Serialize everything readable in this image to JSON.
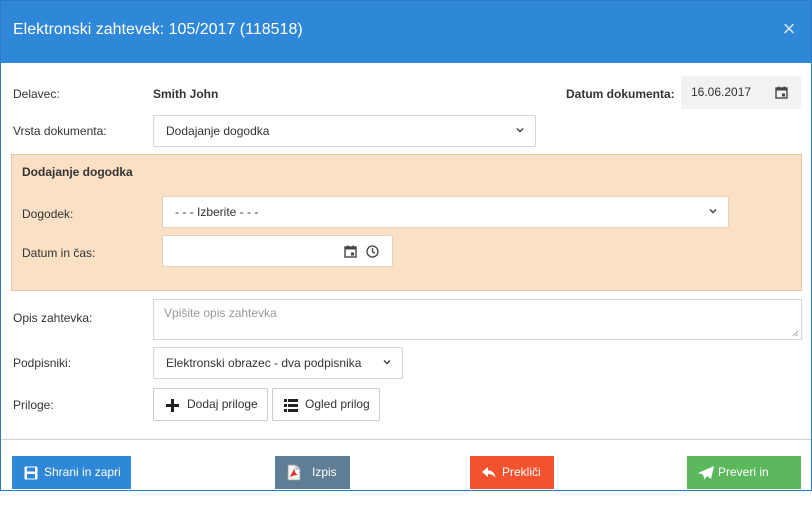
{
  "dialog": {
    "title": "Elektronski zahtevek: 105/2017 (118518)",
    "close_glyph": "×"
  },
  "worker": {
    "label": "Delavec:",
    "value": "Smith John"
  },
  "doc_date": {
    "label": "Datum dokumenta:",
    "value": "16.06.2017"
  },
  "doc_type": {
    "label": "Vrsta dokumenta:",
    "value": "Dodajanje dogodka"
  },
  "event_panel": {
    "title": "Dodajanje dogodka",
    "event_label": "Dogodek:",
    "event_value": "- - - Izberite - - -",
    "datetime_label": "Datum in čas:",
    "datetime_value": ""
  },
  "description": {
    "label": "Opis zahtevka:",
    "placeholder": "Vpišite opis zahtevka"
  },
  "signers": {
    "label": "Podpisniki:",
    "value": "Elektronski obrazec - dva podpisnika"
  },
  "attachments": {
    "label": "Priloge:",
    "add_label": "Dodaj priloge",
    "view_label": "Ogled prilog"
  },
  "footer": {
    "save_label": "Shrani in zapri",
    "print_label": "Izpis",
    "cancel_label": "Prekliči",
    "submit_label": "Preveri in oddaj"
  },
  "colors": {
    "header": "#2f87d8",
    "save": "#2f87d8",
    "print": "#5f7d95",
    "cancel": "#f2522e",
    "submit": "#5cb85c",
    "panel": "#fae0c4"
  }
}
